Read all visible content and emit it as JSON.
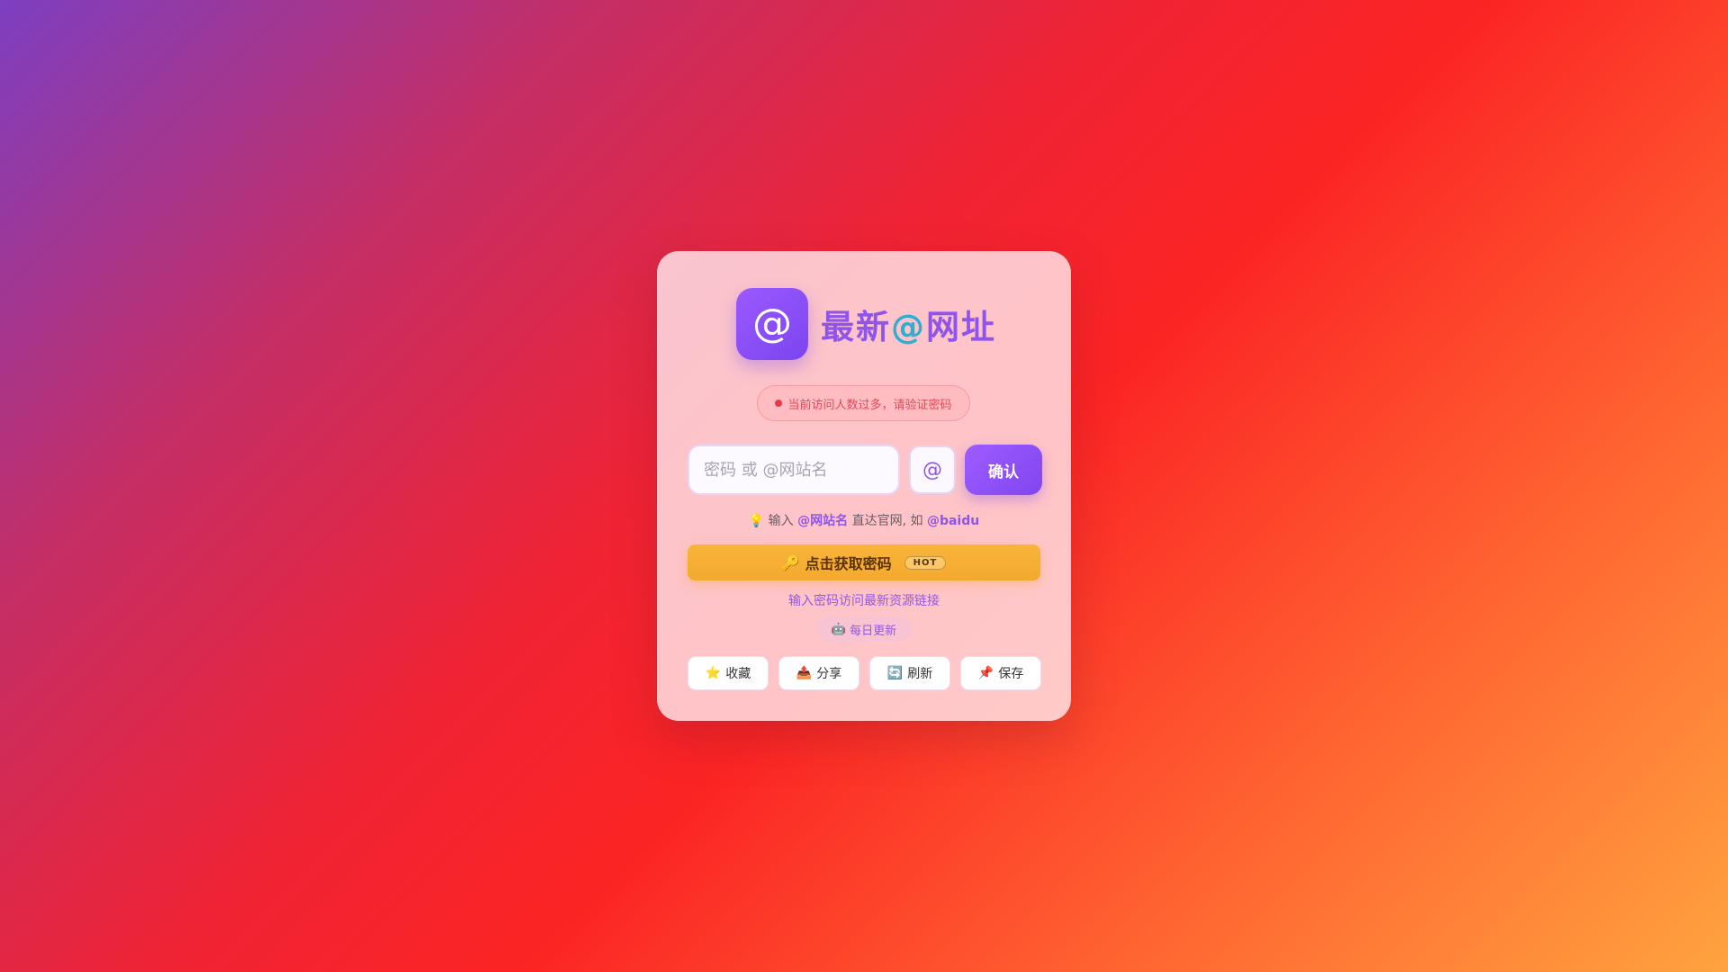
{
  "brand": {
    "logo_symbol": "@",
    "title_part1": "最新",
    "title_at": "@",
    "title_part2": "网址",
    "logo_color": "#8f55ea",
    "accent_color": "#2eaed0"
  },
  "notice": {
    "text": "当前访问人数过多，请验证密码",
    "dot_color": "#e73a4a"
  },
  "form": {
    "password_placeholder": "密码 或 @网站名",
    "password_value": "",
    "at_button_label": "@",
    "confirm_label": "确认"
  },
  "hint": {
    "icon": "💡",
    "prefix": "输入",
    "highlight1": "@网站名",
    "middle": "直达官网, 如",
    "highlight2": "@baidu"
  },
  "get_password": {
    "icon": "🔑",
    "label": "点击获取密码",
    "badge": "HOT",
    "color": "#f6ae33"
  },
  "subtitle": "输入密码访问最新资源链接",
  "daily": {
    "icon": "🤖",
    "label": "每日更新"
  },
  "actions": [
    {
      "icon": "⭐",
      "icon_name": "star-icon",
      "label": "收藏"
    },
    {
      "icon": "📤",
      "icon_name": "share-icon",
      "label": "分享"
    },
    {
      "icon": "🔄",
      "icon_name": "refresh-icon",
      "label": "刷新"
    },
    {
      "icon": "📌",
      "icon_name": "pin-icon",
      "label": "保存"
    }
  ]
}
